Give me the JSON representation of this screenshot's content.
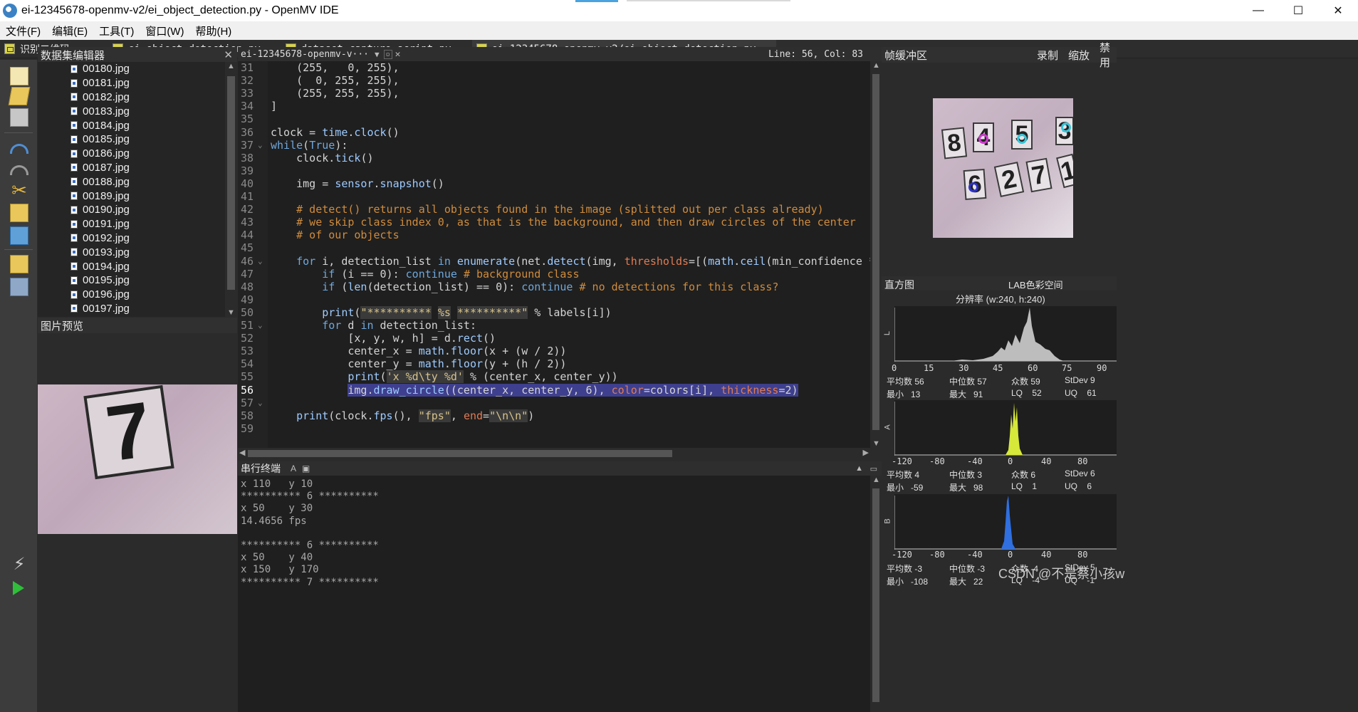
{
  "window": {
    "title": "ei-12345678-openmv-v2/ei_object_detection.py - OpenMV IDE",
    "minimize": "—",
    "maximize": "☐",
    "close": "✕"
  },
  "menu": [
    "文件(F)",
    "编辑(E)",
    "工具(T)",
    "窗口(W)",
    "帮助(H)"
  ],
  "tabs": [
    "识别二维码.py",
    "ei_object_detection.py",
    "dataset_capture_script.py",
    "ei-12345678-openmv-v2/ei_object_detection.py"
  ],
  "dataset_panel": {
    "title": "数据集编辑器",
    "files": [
      "00180.jpg",
      "00181.jpg",
      "00182.jpg",
      "00183.jpg",
      "00184.jpg",
      "00185.jpg",
      "00186.jpg",
      "00187.jpg",
      "00188.jpg",
      "00189.jpg",
      "00190.jpg",
      "00191.jpg",
      "00192.jpg",
      "00193.jpg",
      "00194.jpg",
      "00195.jpg",
      "00196.jpg",
      "00197.jpg"
    ]
  },
  "preview_panel": {
    "title": "图片预览",
    "digit": "7"
  },
  "editor": {
    "file_selector": "ei-12345678-openmv-v···",
    "cursor": "Line: 56, Col: 83",
    "current_line": 56,
    "line_numbers": [
      "31",
      "32",
      "33",
      "34",
      "35",
      "36",
      "37",
      "38",
      "39",
      "40",
      "41",
      "42",
      "43",
      "44",
      "45",
      "46",
      "47",
      "48",
      "49",
      "50",
      "51",
      "52",
      "53",
      "54",
      "55",
      "56",
      "57",
      "58",
      "59"
    ]
  },
  "terminal": {
    "title": "串行终端",
    "lines": [
      "x 110   y 10",
      "********** 6 **********",
      "x 50    y 30",
      "14.4656 fps",
      "",
      "********** 6 **********",
      "x 50    y 40",
      "x 150   y 170",
      "********** 7 **********"
    ]
  },
  "frame_buffer": {
    "title": "帧缓冲区",
    "record": "录制",
    "zoom": "缩放",
    "disable": "禁用",
    "digits": [
      "8",
      "4",
      "5",
      "3",
      "6",
      "2",
      "7",
      "1"
    ]
  },
  "histogram": {
    "title": "直方图",
    "colorspace": "LAB色彩空间",
    "resolution": "分辨率 (w:240, h:240)",
    "L": {
      "axis": [
        "0",
        "15",
        "30",
        "45",
        "60",
        "75",
        "90"
      ],
      "row1": [
        "平均数 56",
        "中位数 57",
        "众数 59",
        "StDev 9"
      ],
      "row2": [
        "最小   13",
        "最大   91",
        "LQ    52",
        "UQ    61"
      ]
    },
    "A": {
      "axis": [
        "-120",
        "-80",
        "-40",
        "0",
        "40",
        "80"
      ],
      "row1": [
        "平均数 4",
        "中位数 3",
        "众数 6",
        "StDev 6"
      ],
      "row2": [
        "最小   -59",
        "最大   98",
        "LQ    1",
        "UQ    6"
      ]
    },
    "B": {
      "axis": [
        "-120",
        "-80",
        "-40",
        "0",
        "40",
        "80"
      ],
      "row1": [
        "平均数 -3",
        "中位数 -3",
        "众数 -4",
        "StDev 5"
      ],
      "row2": [
        "最小   -108",
        "最大   22",
        "LQ    -4",
        "UQ    -1"
      ]
    }
  },
  "watermark": "CSDN @不是蔡小孩w",
  "colors": {
    "accent": "#4aa3df",
    "selection": "#3f3f8f",
    "keyword": "#6fa8dc",
    "comment": "#d08c3c"
  }
}
